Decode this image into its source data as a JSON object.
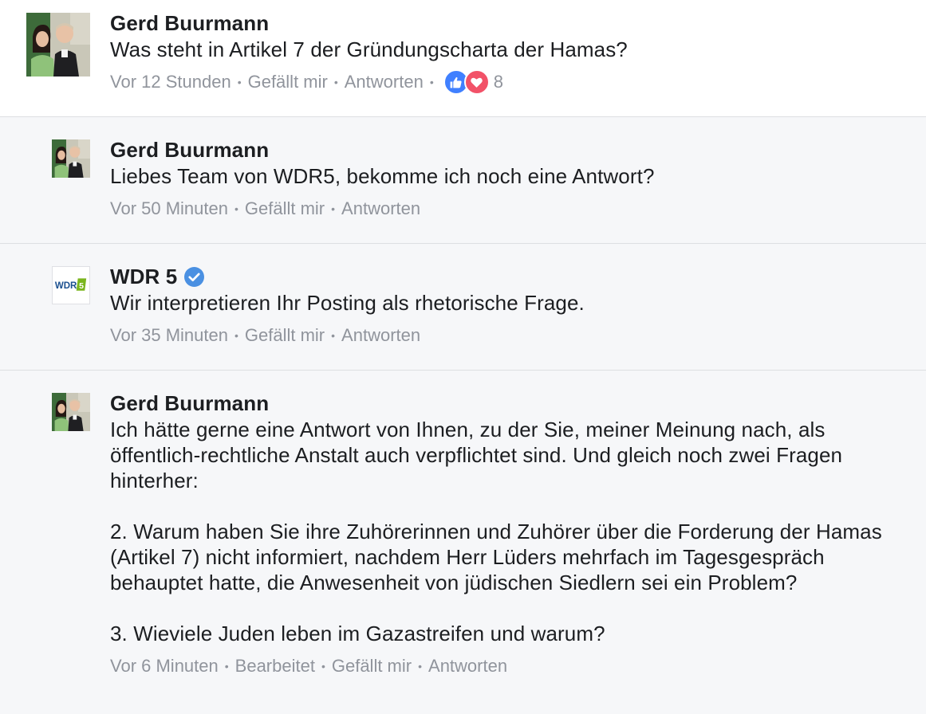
{
  "comments": [
    {
      "author": "Gerd Buurmann",
      "text": "Was steht in Artikel 7 der Gründungscharta der Hamas?",
      "time": "Vor 12 Stunden",
      "like": "Gefällt mir",
      "reply": "Antworten",
      "reactions": {
        "icons": [
          "like-icon",
          "love-icon"
        ],
        "count": "8"
      }
    },
    {
      "author": "Gerd Buurmann",
      "text": "Liebes Team von WDR5, bekomme ich noch eine Antwort?",
      "time": "Vor 50 Minuten",
      "like": "Gefällt mir",
      "reply": "Antworten"
    },
    {
      "author": "WDR 5",
      "verified": true,
      "logo_text": "WDR",
      "logo_badge": "5",
      "text": "Wir interpretieren Ihr Posting als rhetorische Frage.",
      "time": "Vor 35 Minuten",
      "like": "Gefällt mir",
      "reply": "Antworten"
    },
    {
      "author": "Gerd Buurmann",
      "text": "Ich hätte gerne eine Antwort von Ihnen, zu der Sie, meiner Meinung nach, als öffentlich-rechtliche Anstalt auch verpflichtet sind. Und gleich noch zwei Fragen hinterher:\n\n2. Warum haben Sie ihre Zuhörerinnen und Zuhörer über die Forderung der Hamas (Artikel 7) nicht informiert, nachdem Herr Lüders mehrfach im Tagesgespräch behauptet hatte, die Anwesenheit von jüdischen Siedlern sei ein Problem?\n\n3. Wieviele Juden leben im Gazastreifen und warum?",
      "time": "Vor 6 Minuten",
      "edited": "Bearbeitet",
      "like": "Gefällt mir",
      "reply": "Antworten"
    }
  ],
  "colors": {
    "like_blue": "#4080ff",
    "love_red": "#f25268",
    "verified_blue": "#4a90e2",
    "meta_gray": "#90949c",
    "wdr_blue": "#1a4f8f",
    "wdr_green": "#7ab51d"
  }
}
